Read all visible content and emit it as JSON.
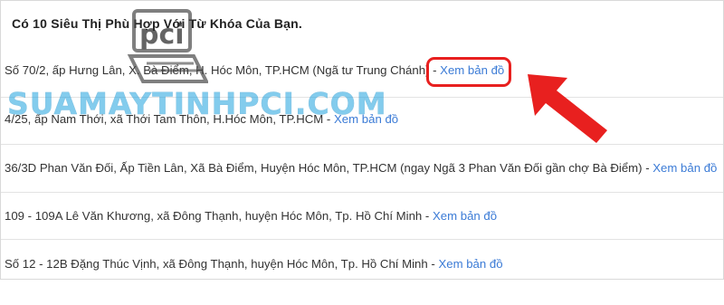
{
  "heading": "Có 10 Siêu Thị Phù Hợp Với Từ Khóa Của Bạn.",
  "separator": " - ",
  "stores": [
    {
      "address": "Số 70/2, ấp Hưng Lân, X. Bà Điểm, H. Hóc Môn, TP.HCM (Ngã tư Trung Chánh)",
      "map_link": "Xem bản đồ"
    },
    {
      "address": "4/25, ấp Nam Thới, xã Thới Tam Thôn, H.Hóc Môn, TP.HCM",
      "map_link": "Xem bản đồ"
    },
    {
      "address": "36/3D Phan Văn Đối, Ấp Tiền Lân, Xã Bà Điểm, Huyện Hóc Môn, TP.HCM (ngay Ngã 3 Phan Văn Đối gần chợ Bà Điểm)",
      "map_link": "Xem bản đồ"
    },
    {
      "address": "109 - 109A Lê Văn Khương, xã Đông Thạnh, huyện Hóc Môn, Tp. Hồ Chí Minh",
      "map_link": "Xem bản đồ"
    },
    {
      "address": "Số 12 - 12B Đặng Thúc Vịnh, xã Đông Thạnh, huyện Hóc Môn, Tp. Hồ Chí Minh",
      "map_link": "Xem bản đồ"
    }
  ],
  "watermark": {
    "logo_text": "pci",
    "brand_text": "SUAMAYTINHPCI.COM",
    "color": "#1fa3e0"
  },
  "annotation": {
    "highlight_color": "#e8201f",
    "arrow_color": "#e8201f"
  },
  "link_color": "#3b7bd6"
}
